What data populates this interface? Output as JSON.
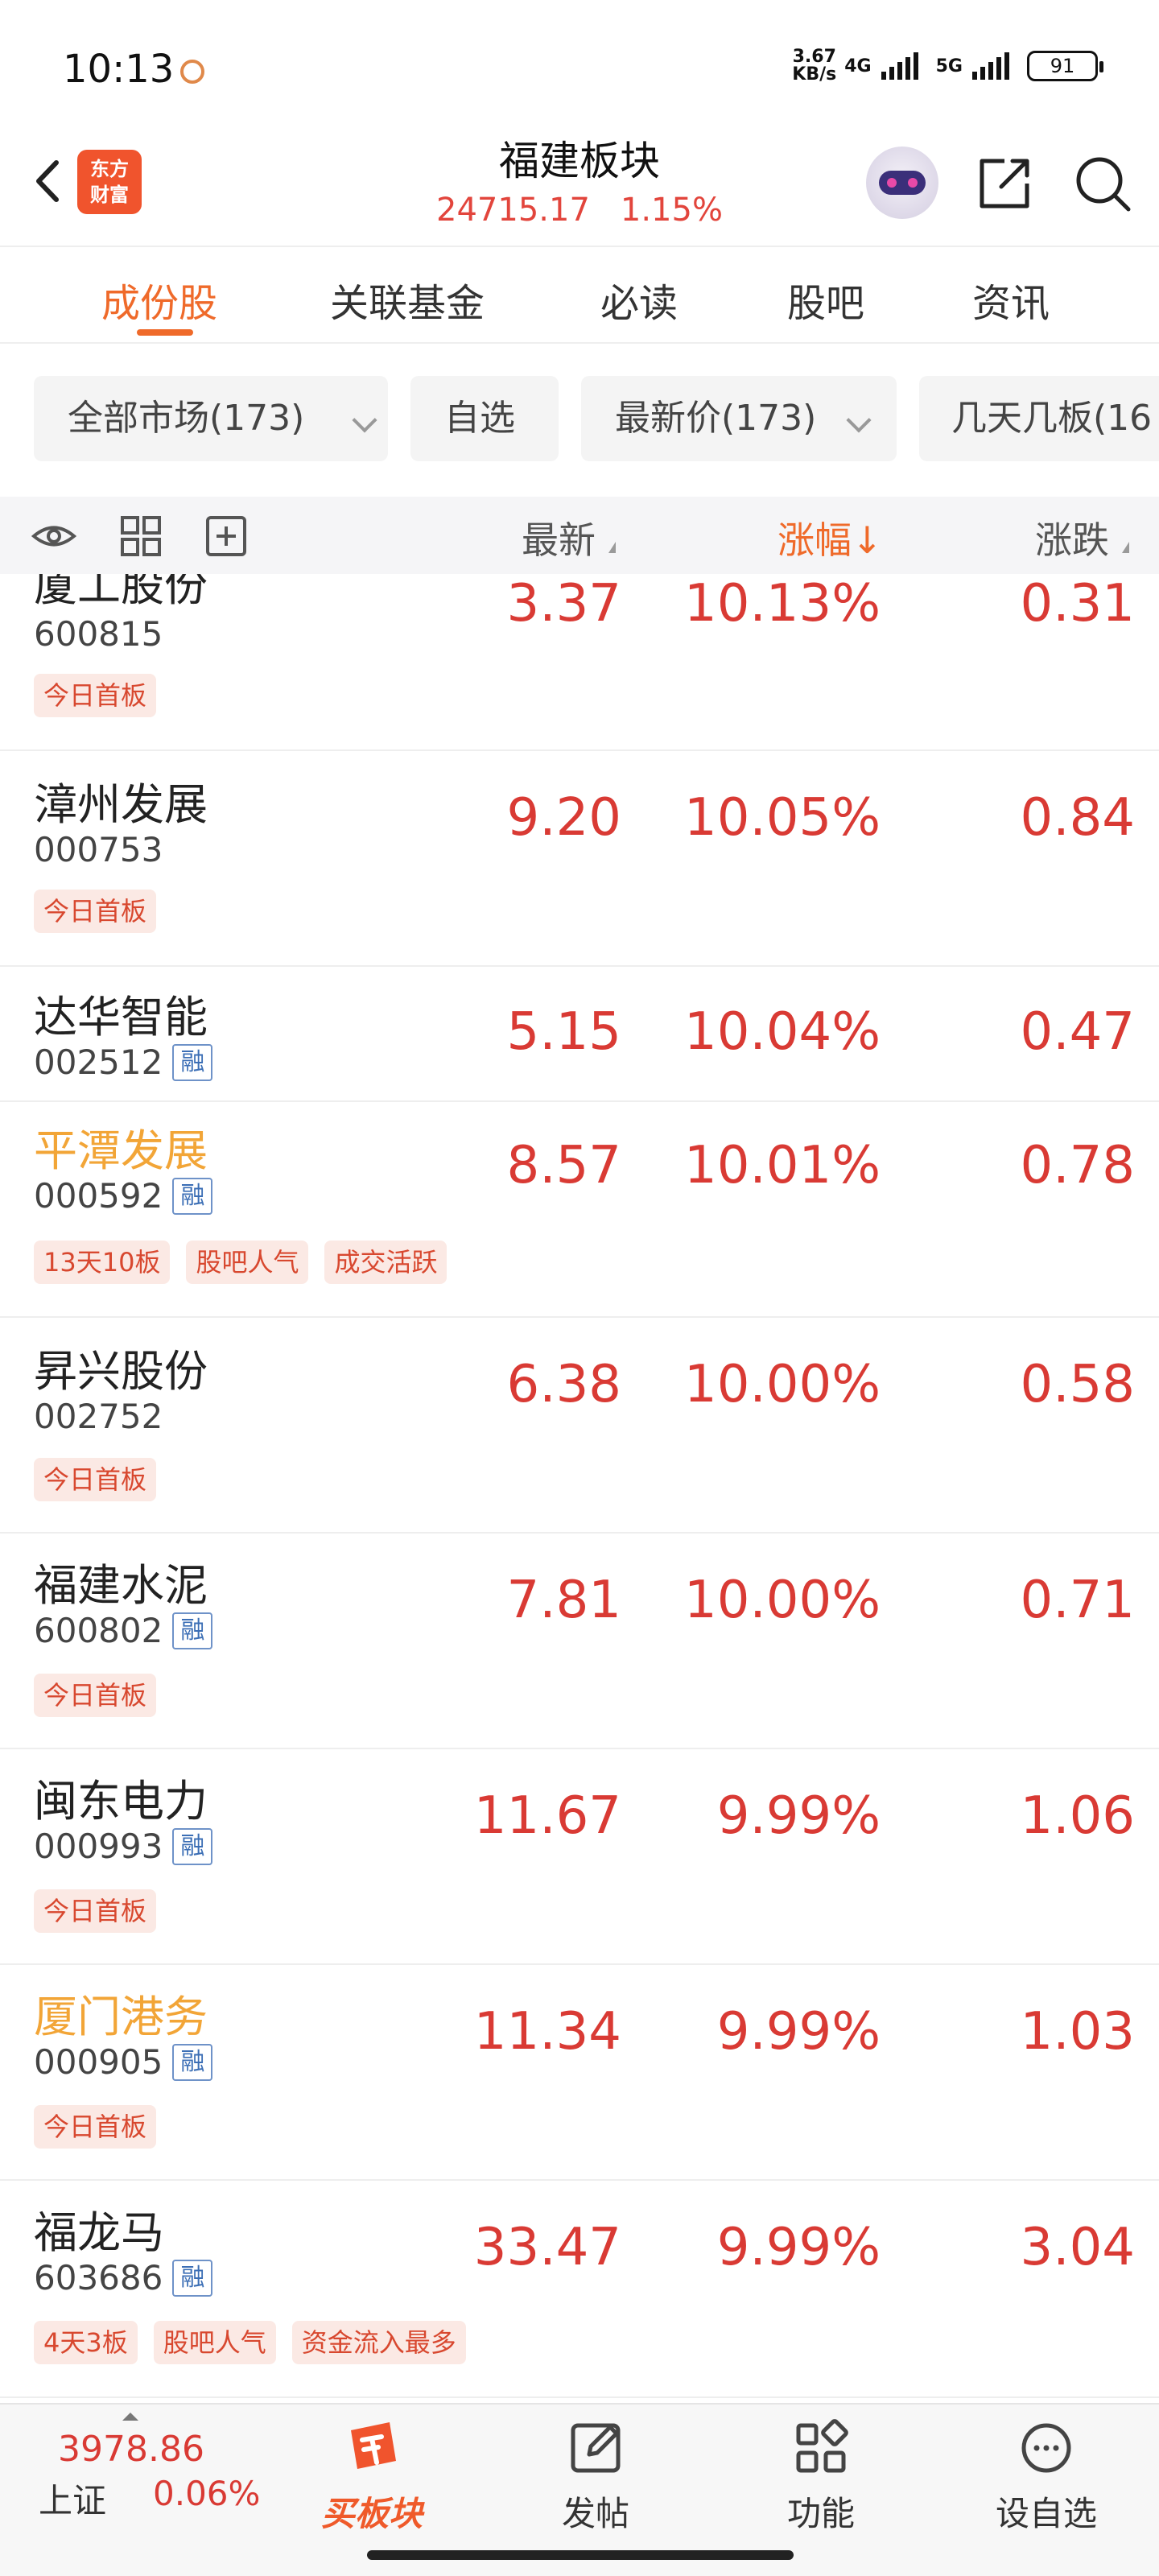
{
  "status_bar": {
    "time": "10:13",
    "net_speed_value": "3.67",
    "net_speed_unit": "KB/s",
    "net_type_1": "4G",
    "net_type_2": "5G",
    "battery": "91"
  },
  "header": {
    "back_icon": "chevron-left-icon",
    "logo_line1": "东方",
    "logo_line2": "财富",
    "title": "福建板块",
    "index_value": "24715.17",
    "index_change": "1.15%",
    "actions": [
      "robot-avatar-icon",
      "share-icon",
      "search-icon"
    ]
  },
  "tabs": [
    {
      "label": "成份股",
      "active": true
    },
    {
      "label": "关联基金",
      "active": false
    },
    {
      "label": "必读",
      "active": false
    },
    {
      "label": "股吧",
      "active": false
    },
    {
      "label": "资讯",
      "active": false
    }
  ],
  "filters": {
    "market": "全部市场(173)",
    "watchlist": "自选",
    "latest_price": "最新价(173)",
    "limit_up": "几天几板(16"
  },
  "columns": {
    "icons": [
      "eye-icon",
      "grid-icon",
      "add-box-icon"
    ],
    "latest": "最新",
    "change_pct": "涨幅",
    "change": "涨跌"
  },
  "stocks": [
    {
      "name": "厦工股份",
      "code": "600815",
      "rong": false,
      "highlight": false,
      "tags": [
        "今日首板"
      ],
      "price": "3.37",
      "pct": "10.13%",
      "chg": "0.31"
    },
    {
      "name": "漳州发展",
      "code": "000753",
      "rong": false,
      "highlight": false,
      "tags": [
        "今日首板"
      ],
      "price": "9.20",
      "pct": "10.05%",
      "chg": "0.84"
    },
    {
      "name": "达华智能",
      "code": "002512",
      "rong": true,
      "highlight": false,
      "tags": [],
      "price": "5.15",
      "pct": "10.04%",
      "chg": "0.47"
    },
    {
      "name": "平潭发展",
      "code": "000592",
      "rong": true,
      "highlight": true,
      "tags": [
        "13天10板",
        "股吧人气",
        "成交活跃"
      ],
      "price": "8.57",
      "pct": "10.01%",
      "chg": "0.78"
    },
    {
      "name": "昇兴股份",
      "code": "002752",
      "rong": false,
      "highlight": false,
      "tags": [
        "今日首板"
      ],
      "price": "6.38",
      "pct": "10.00%",
      "chg": "0.58"
    },
    {
      "name": "福建水泥",
      "code": "600802",
      "rong": true,
      "highlight": false,
      "tags": [
        "今日首板"
      ],
      "price": "7.81",
      "pct": "10.00%",
      "chg": "0.71"
    },
    {
      "name": "闽东电力",
      "code": "000993",
      "rong": true,
      "highlight": false,
      "tags": [
        "今日首板"
      ],
      "price": "11.67",
      "pct": "9.99%",
      "chg": "1.06"
    },
    {
      "name": "厦门港务",
      "code": "000905",
      "rong": true,
      "highlight": true,
      "tags": [
        "今日首板"
      ],
      "price": "11.34",
      "pct": "9.99%",
      "chg": "1.03"
    },
    {
      "name": "福龙马",
      "code": "603686",
      "rong": true,
      "highlight": false,
      "tags": [
        "4天3板",
        "股吧人气",
        "资金流入最多"
      ],
      "price": "33.47",
      "pct": "9.99%",
      "chg": "3.04"
    }
  ],
  "rong_label": "融",
  "bottom": {
    "index_value": "3978.86",
    "index_name": "上证",
    "index_pct": "0.06%",
    "nav": [
      {
        "label": "买板块",
        "icon": "buy-board-icon",
        "active": true
      },
      {
        "label": "发帖",
        "icon": "edit-post-icon",
        "active": false
      },
      {
        "label": "功能",
        "icon": "function-grid-icon",
        "active": false
      },
      {
        "label": "设自选",
        "icon": "more-dots-icon",
        "active": false
      }
    ]
  },
  "colors": {
    "accent": "#ef6a2a",
    "up_red": "#d93a34",
    "highlight_name": "#f2a537",
    "tag_bg": "#fbe9e4"
  }
}
